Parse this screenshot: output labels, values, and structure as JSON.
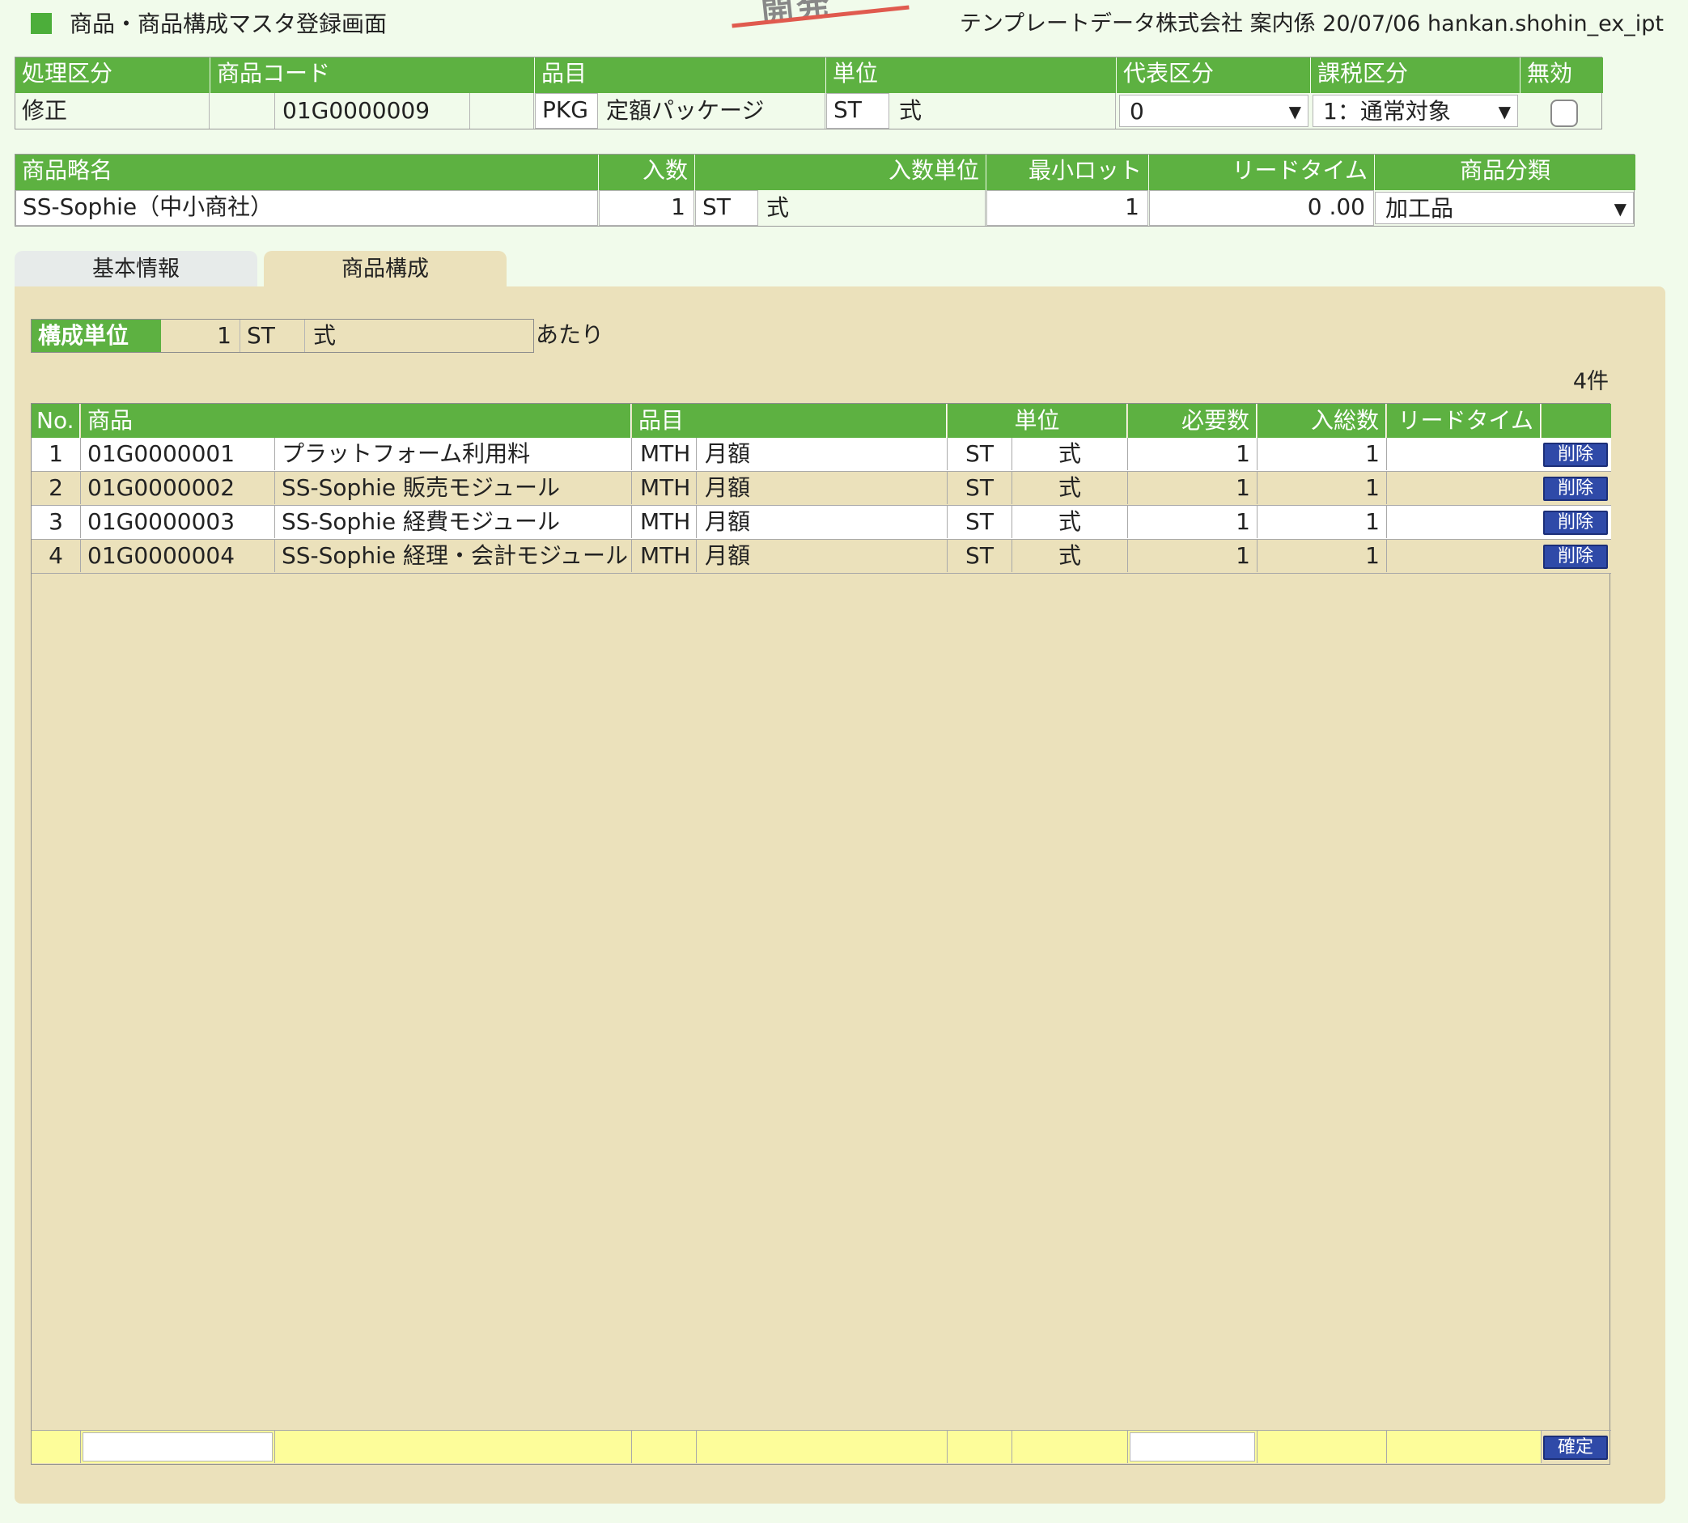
{
  "header": {
    "title": "商品・商品構成マスタ登録画面",
    "stamp": "開発",
    "meta": "テンプレートデータ株式会社 案内係 20/07/06 hankan.shohin_ex_ipt"
  },
  "top": {
    "labels": {
      "process": "処理区分",
      "product_code": "商品コード",
      "item": "品目",
      "unit": "単位",
      "representative": "代表区分",
      "tax": "課税区分",
      "invalid": "無効"
    },
    "process": "修正",
    "product_code": "01G0000009",
    "item_code": "PKG",
    "item_name": "定額パッケージ",
    "unit_code": "ST",
    "unit_name": "式",
    "representative": "0",
    "tax": "1：通常対象",
    "invalid_checked": false
  },
  "second": {
    "labels": {
      "short_name": "商品略名",
      "quantity": "入数",
      "quantity_unit": "入数単位",
      "min_lot": "最小ロット",
      "lead_time": "リードタイム",
      "category": "商品分類"
    },
    "short_name": "SS-Sophie（中小商社）",
    "quantity": "1",
    "quantity_unit_code": "ST",
    "quantity_unit_name": "式",
    "min_lot": "1",
    "lead_time": "0 .00",
    "category": "加工品"
  },
  "tabs": [
    {
      "label": "基本情報",
      "active": false
    },
    {
      "label": "商品構成",
      "active": true
    }
  ],
  "composition": {
    "label": "構成単位",
    "qty": "1",
    "unit_code": "ST",
    "unit_name": "式",
    "suffix": "あたり",
    "count": "4件"
  },
  "table": {
    "headers": {
      "no": "No.",
      "product": "商品",
      "item": "品目",
      "unit": "単位",
      "required": "必要数",
      "total": "入総数",
      "lead_time": "リードタイム"
    },
    "rows": [
      {
        "no": "1",
        "code": "01G0000001",
        "name": "プラットフォーム利用料",
        "item_code": "MTH",
        "item_name": "月額",
        "unit_code": "ST",
        "unit_name": "式",
        "required": "1",
        "total": "1",
        "lead_time": "",
        "delete": "削除"
      },
      {
        "no": "2",
        "code": "01G0000002",
        "name": "SS-Sophie 販売モジュール",
        "item_code": "MTH",
        "item_name": "月額",
        "unit_code": "ST",
        "unit_name": "式",
        "required": "1",
        "total": "1",
        "lead_time": "",
        "delete": "削除"
      },
      {
        "no": "3",
        "code": "01G0000003",
        "name": "SS-Sophie 経費モジュール",
        "item_code": "MTH",
        "item_name": "月額",
        "unit_code": "ST",
        "unit_name": "式",
        "required": "1",
        "total": "1",
        "lead_time": "",
        "delete": "削除"
      },
      {
        "no": "4",
        "code": "01G0000004",
        "name": "SS-Sophie 経理・会計モジュール",
        "item_code": "MTH",
        "item_name": "月額",
        "unit_code": "ST",
        "unit_name": "式",
        "required": "1",
        "total": "1",
        "lead_time": "",
        "delete": "削除"
      }
    ],
    "confirm": "確定"
  },
  "colors": {
    "header_green": "#5db141",
    "page_bg": "#f1fbeb",
    "panel_bg": "#ebe1bb",
    "footer_yellow": "#fdfd9a",
    "button_blue": "#2f4aa8"
  }
}
